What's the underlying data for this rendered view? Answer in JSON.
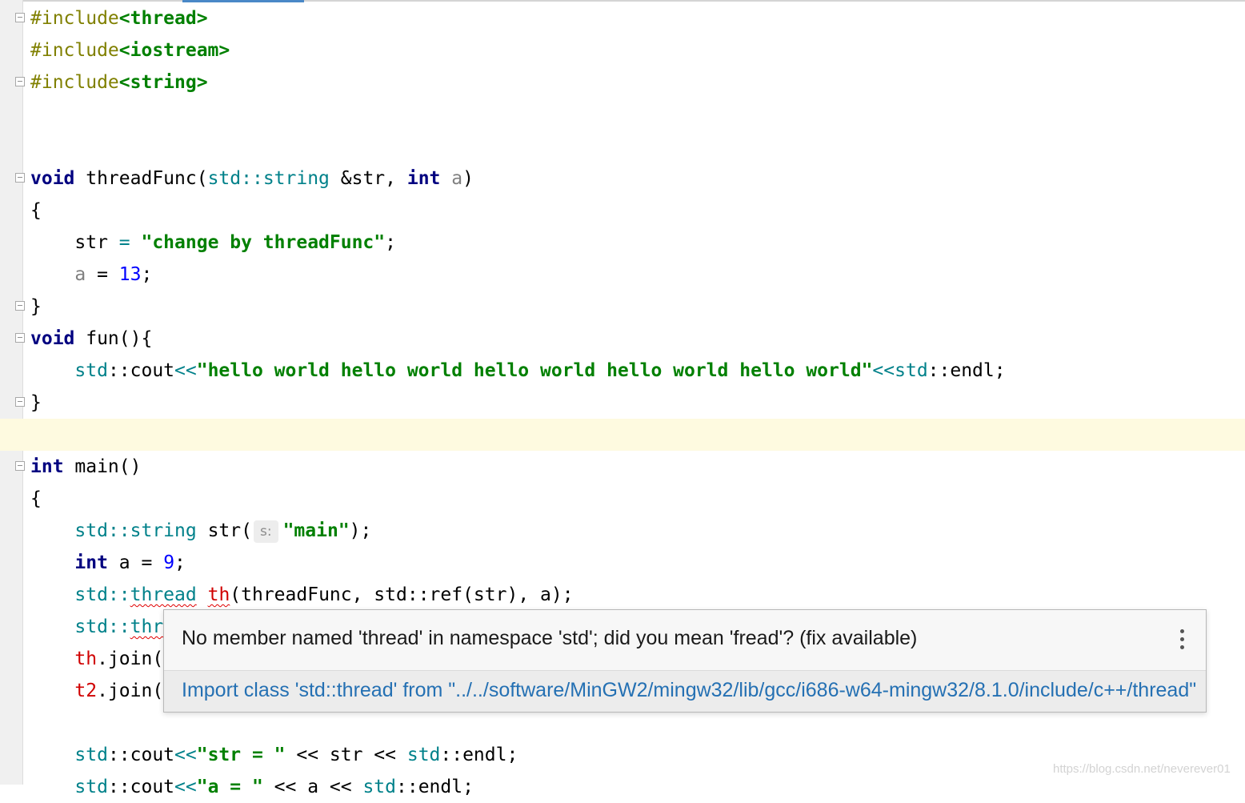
{
  "editor": {
    "lines": {
      "inc1_dir": "#include",
      "inc1_hdr": "<thread>",
      "inc2_dir": "#include",
      "inc2_hdr": "<iostream>",
      "inc3_dir": "#include",
      "inc3_hdr": "<string>",
      "l6_kw": "void",
      "l6_name": " threadFunc(",
      "l6_ns": "std",
      "l6_sep": "::",
      "l6_type": "string",
      "l6_rest": " &str, ",
      "l6_kw2": "int",
      "l6_param": "a",
      "l6_end": ")",
      "l7": "{",
      "l8_var": "str",
      "l8_op": " = ",
      "l8_str": "\"change by threadFunc\"",
      "l8_end": ";",
      "l9_var": "a",
      "l9_op": " = ",
      "l9_num": "13",
      "l9_end": ";",
      "l10": "}",
      "l11_kw": "void",
      "l11_rest": " fun(){",
      "l12_ns": "std",
      "l12_a": "::cout",
      "l12_op": "<<",
      "l12_str": "\"hello world hello world hello world hello world hello world\"",
      "l12_op2": "<<",
      "l12_ns2": "std",
      "l12_b": "::endl;",
      "l13": "}",
      "l15_kw": "int",
      "l15_rest": " main()",
      "l16": "{",
      "l17_ns": "std",
      "l17_a": "::",
      "l17_type": "string",
      "l17_b": " str(",
      "l17_hint": "s:",
      "l17_str": "\"main\"",
      "l17_end": ");",
      "l18_kw": "int",
      "l18_a": " a = ",
      "l18_num": "9",
      "l18_end": ";",
      "l19_ns": "std",
      "l19_a": "::",
      "l19_err": "thread",
      "l19_sp": " ",
      "l19_var": "th",
      "l19_b": "(threadFunc, std::ref(str), a);",
      "l20_ns": "std",
      "l20_a": "::",
      "l20_err": "thr",
      "l21_var": "th",
      "l21_b": ".join(",
      "l22_var": "t2",
      "l22_b": ".join(",
      "l24_ns": "std",
      "l24_a": "::cout",
      "l24_op": "<<",
      "l24_str": "\"str = \"",
      "l24_b": " << str << ",
      "l24_ns2": "std",
      "l24_c": "::endl;",
      "l25_ns": "std",
      "l25_a": "::cout",
      "l25_op": "<<",
      "l25_str": "\"a = \"",
      "l25_b": " << a << ",
      "l25_ns2": "std",
      "l25_c": "::endl;"
    }
  },
  "popup": {
    "message": "No member named 'thread' in namespace 'std'; did you mean 'fread'? (fix available)",
    "fix": "Import class 'std::thread' from \"../../software/MinGW2/mingw32/lib/gcc/i686-w64-mingw32/8.1.0/include/c++/thread\""
  },
  "watermark": "https://blog.csdn.net/neverever01",
  "colors": {
    "keyword": "#000080",
    "string": "#008000",
    "namespace": "#00818a",
    "number": "#0000ff",
    "preprocessor": "#808000",
    "error": "#e00000",
    "link": "#2470b3",
    "highlight_line": "#fefae0"
  }
}
